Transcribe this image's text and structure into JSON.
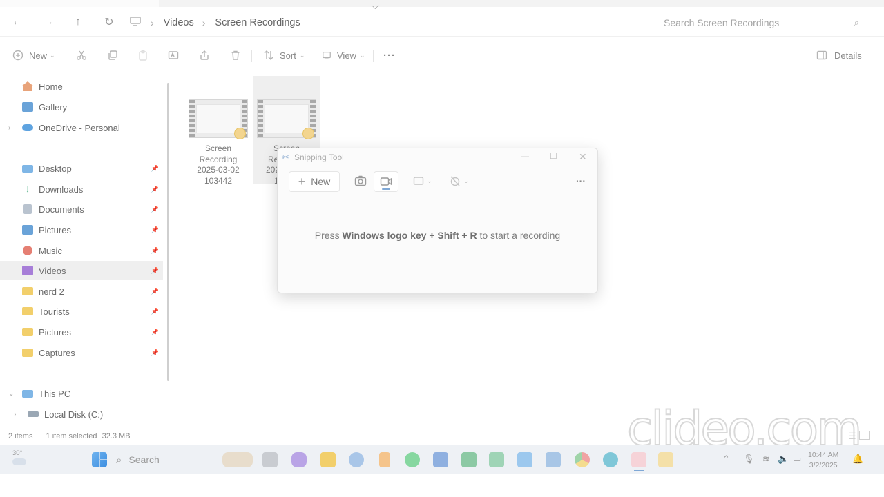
{
  "address": {
    "crumbs": [
      "Videos",
      "Screen Recordings"
    ]
  },
  "search": {
    "placeholder": "Search Screen Recordings"
  },
  "toolbar": {
    "new_label": "New",
    "sort_label": "Sort",
    "view_label": "View",
    "more_label": "···",
    "details_label": "Details"
  },
  "sidebar": {
    "top": [
      {
        "label": "Home",
        "icon": "home-icon",
        "color": "#e8a37a"
      },
      {
        "label": "Gallery",
        "icon": "gallery-icon",
        "color": "#6aa3d8"
      },
      {
        "label": "OneDrive - Personal",
        "icon": "cloud-icon",
        "color": "#5ea3e0"
      }
    ],
    "quick": [
      {
        "label": "Desktop",
        "icon": "desktop-icon",
        "color": "#7fb6e6"
      },
      {
        "label": "Downloads",
        "icon": "download-icon",
        "color": "#58b48a"
      },
      {
        "label": "Documents",
        "icon": "document-icon",
        "color": "#b9c3cf"
      },
      {
        "label": "Pictures",
        "icon": "pictures-icon",
        "color": "#6aa3d8"
      },
      {
        "label": "Music",
        "icon": "music-icon",
        "color": "#e57f73"
      },
      {
        "label": "Videos",
        "icon": "videos-icon",
        "color": "#a77ed8"
      },
      {
        "label": "nerd 2",
        "icon": "folder-icon",
        "color": "#f2cf6b"
      },
      {
        "label": "Tourists",
        "icon": "folder-icon",
        "color": "#f2cf6b"
      },
      {
        "label": "Pictures",
        "icon": "folder-icon",
        "color": "#f2cf6b"
      },
      {
        "label": "Captures",
        "icon": "folder-icon",
        "color": "#f2cf6b"
      }
    ],
    "pc": [
      {
        "label": "This PC",
        "icon": "pc-icon",
        "color": "#7fb6e6"
      },
      {
        "label": "Local Disk (C:)",
        "icon": "disk-icon",
        "color": "#9aa7b4"
      }
    ]
  },
  "files": [
    {
      "lines": [
        "Screen",
        "Recording",
        "2025-03-02",
        "103442"
      ]
    },
    {
      "lines": [
        "Screen",
        "Re",
        "202",
        "1"
      ]
    }
  ],
  "status": {
    "items": "2 items",
    "selected": "1 item selected",
    "size": "32.3 MB"
  },
  "snipping_tool": {
    "title": "Snipping Tool",
    "new_label": "New",
    "message_pre": "Press ",
    "message_key": "Windows logo key + Shift + R",
    "message_post": " to start a recording"
  },
  "watermark": "clideo.com",
  "taskbar": {
    "weather": "30°",
    "search_label": "Search",
    "time": "10:44 AM",
    "date": "3/2/2025"
  }
}
